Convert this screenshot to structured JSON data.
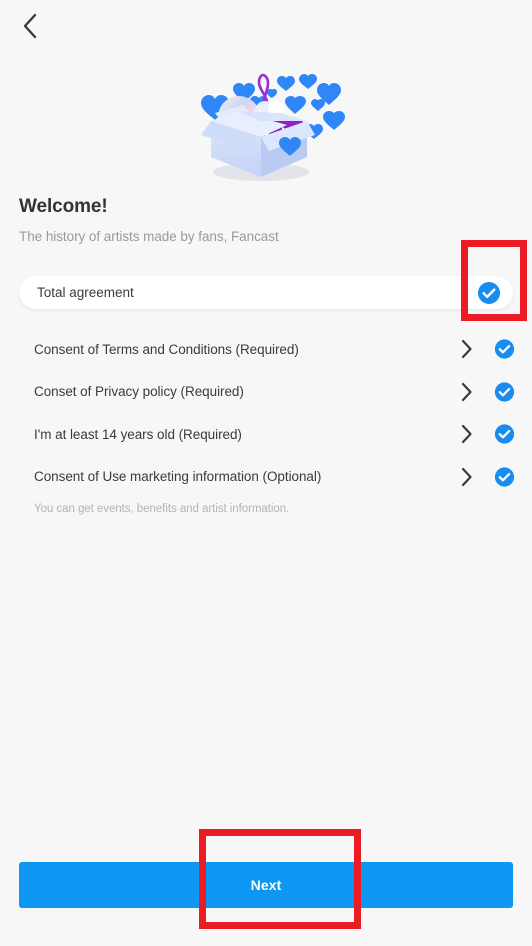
{
  "nav": {
    "back_icon": "chevron-left-icon"
  },
  "illustration": {
    "name": "gift-box-with-hearts-music-illustration",
    "elements": [
      "open-box",
      "blue-hearts",
      "cd-disc",
      "purple-play-card",
      "treble-clef"
    ],
    "colors": {
      "box": "#ccd9f7",
      "heart": "#1e7cf5",
      "play_card": "#8b24c4",
      "clef": "#9b2fd6"
    }
  },
  "header": {
    "title": "Welcome!",
    "subtitle": "The history of artists made by fans, Fancast"
  },
  "total_agreement": {
    "label": "Total agreement",
    "checked": true,
    "check_icon": "check-circle-icon"
  },
  "consents": [
    {
      "label": "Consent of Terms and Conditions (Required)",
      "chevron_icon": "chevron-right-icon",
      "check_icon": "check-circle-icon",
      "checked": true
    },
    {
      "label": "Conset of Privacy policy (Required)",
      "chevron_icon": "chevron-right-icon",
      "check_icon": "check-circle-icon",
      "checked": true
    },
    {
      "label": "I'm at least 14 years old (Required)",
      "chevron_icon": "chevron-right-icon",
      "check_icon": "check-circle-icon",
      "checked": true
    },
    {
      "label": "Consent of Use marketing information (Optional)",
      "chevron_icon": "chevron-right-icon",
      "check_icon": "check-circle-icon",
      "checked": true
    }
  ],
  "helper_text": "You can get events, benefits and artist information.",
  "footer": {
    "next_label": "Next"
  },
  "annotations": {
    "highlight_color": "#ec1c24",
    "boxes": [
      "total-agreement-checkbox",
      "next-button"
    ]
  },
  "colors": {
    "background": "#f7f7f7",
    "card": "#ffffff",
    "primary": "#0d96f2",
    "check_blue": "#1a8cf0",
    "title": "#333333",
    "subtitle": "#9a9a9a",
    "body": "#3b3b3b",
    "helper": "#b3b3b3"
  }
}
